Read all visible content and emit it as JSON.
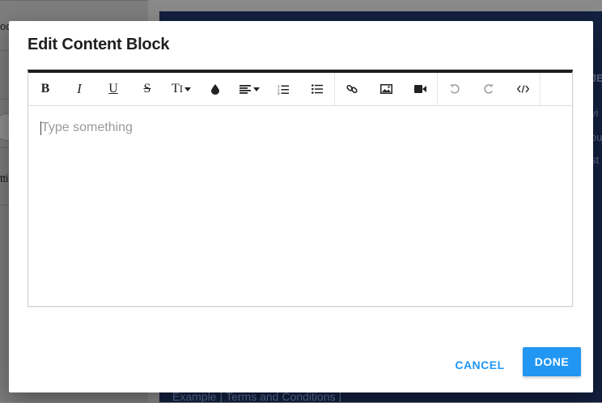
{
  "background": {
    "left_items": [
      "od",
      "",
      "yle",
      "tti"
    ],
    "right_fragments": [
      "JE",
      "vi",
      "ou",
      "st"
    ],
    "footer_links": [
      "Example",
      "Terms and Conditions"
    ]
  },
  "dialog": {
    "title": "Edit Content Block",
    "editor": {
      "placeholder": "Type something",
      "toolbar": [
        {
          "name": "bold-icon",
          "glyph": "B"
        },
        {
          "name": "italic-icon",
          "glyph": "I"
        },
        {
          "name": "underline-icon",
          "glyph": "U"
        },
        {
          "name": "strikethrough-icon",
          "glyph": "S"
        },
        {
          "name": "font-size-icon",
          "glyph": "TI"
        },
        {
          "name": "color-drop-icon"
        },
        {
          "name": "align-icon"
        },
        {
          "name": "ordered-list-icon"
        },
        {
          "name": "unordered-list-icon"
        },
        {
          "name": "link-icon"
        },
        {
          "name": "image-icon"
        },
        {
          "name": "video-icon"
        },
        {
          "name": "undo-icon"
        },
        {
          "name": "redo-icon"
        },
        {
          "name": "code-icon"
        }
      ]
    },
    "cancel_label": "CANCEL",
    "done_label": "DONE"
  },
  "colors": {
    "accent": "#2196f3",
    "toolbar_top_border": "#1f1f1f",
    "placeholder": "#9a9a9a"
  }
}
